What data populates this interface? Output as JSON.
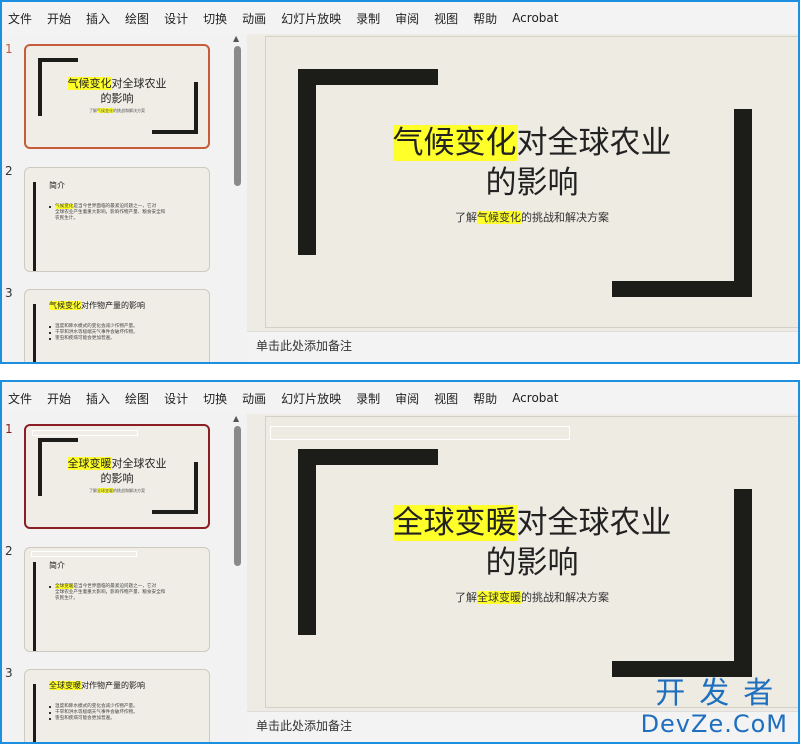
{
  "menu": [
    "文件",
    "开始",
    "插入",
    "绘图",
    "设计",
    "切换",
    "动画",
    "幻灯片放映",
    "录制",
    "审阅",
    "视图",
    "帮助",
    "Acrobat"
  ],
  "notes_placeholder": "单击此处添加备注",
  "top": {
    "keyword": "气候变化",
    "title_rest": "对全球农业",
    "title_line2": "的影响",
    "subtitle_pre": "了解",
    "subtitle_post": "的挑战和解决方案",
    "slide_numbers": [
      "1",
      "2",
      "3"
    ],
    "slide2_heading": "简介",
    "slide2_bullets": [
      "是当今世界面临的最紧迫问题之一，它对",
      "全球农业产生着重大影响，影响作物产量、粮食安全和",
      "农民生计。"
    ],
    "slide3_title_rest": "对作物产量的影响",
    "slide3_bullets": [
      "温度和降水模式的变化会减少作物产量。",
      "干旱和洪水等极端天气事件会破坏作物。",
      "害虫和疾病可能会更加普遍。"
    ]
  },
  "bottom": {
    "keyword": "全球变暖",
    "title_rest": "对全球农业",
    "title_line2": "的影响",
    "subtitle_pre": "了解",
    "subtitle_post": "的挑战和解决方案",
    "slide_numbers": [
      "1",
      "2",
      "3"
    ],
    "slide2_heading": "简介",
    "slide2_bullets": [
      "是当今世界面临的最紧迫问题之一，它对",
      "全球农业产生着重大影响，影响作物产量、粮食安全和",
      "农民生计。"
    ],
    "slide3_title_rest": "对作物产量的影响",
    "slide3_bullets": [
      "温度和降水模式的变化会减少作物产量。",
      "干旱和洪水等极端天气事件会破坏作物。",
      "害虫和疾病可能会更加普遍。"
    ]
  },
  "watermark": {
    "cn": "开发者",
    "en": "DevZe.CoM"
  },
  "colors": {
    "accent_border": "#1d8fe1",
    "highlight": "#ffff2a",
    "thumb_selected_top": "#c65d3a",
    "thumb_selected_bottom": "#8b1e24",
    "bracket": "#1c1c18"
  }
}
